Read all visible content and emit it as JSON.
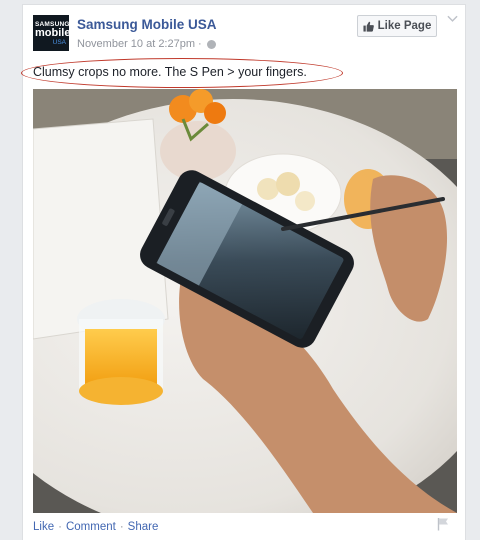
{
  "post": {
    "page_name": "Samsung Mobile USA",
    "avatar_text": {
      "line1": "SAMSUNG",
      "line2": "mobile",
      "line3": "USA"
    },
    "date": "November 10 at 2:27pm",
    "separator": "·",
    "like_page_label": "Like Page",
    "caption": "Clumsy crops no more. The S Pen > your fingers.",
    "actions": {
      "like": "Like",
      "comment": "Comment",
      "share": "Share",
      "dot": "·"
    }
  },
  "colors": {
    "link": "#3b5998",
    "annotation": "#c0392b",
    "background": "#e9ebee"
  },
  "icons": [
    "globe-icon",
    "thumbs-up-icon",
    "chevron-down-icon",
    "flag-icon"
  ]
}
